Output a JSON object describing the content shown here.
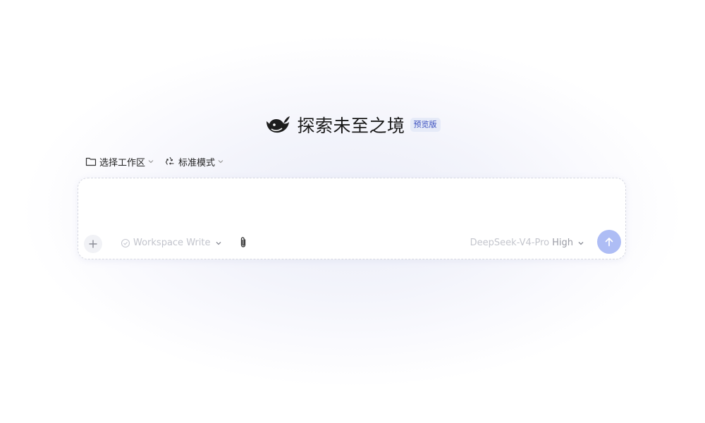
{
  "header": {
    "logo_icon": "deepseek-whale-icon",
    "title": "探索未至之境",
    "badge": "预览版"
  },
  "toolbar": {
    "workspace": {
      "icon": "folder-icon",
      "label": "选择工作区"
    },
    "mode": {
      "icon": "recycle-icon",
      "label": "标准模式"
    }
  },
  "composer": {
    "input_value": "",
    "add_icon": "plus-icon",
    "permission": {
      "icon": "shield-icon",
      "label": "Workspace Write"
    },
    "attach_icon": "paperclip-icon",
    "model": {
      "name": "DeepSeek-V4-Pro",
      "effort": "High"
    },
    "send_icon": "arrow-up-icon"
  },
  "colors": {
    "accent": "#aebdf5",
    "badge_bg": "#e6ebf8",
    "badge_text": "#3a4fbf",
    "border": "#d7d9e2"
  }
}
